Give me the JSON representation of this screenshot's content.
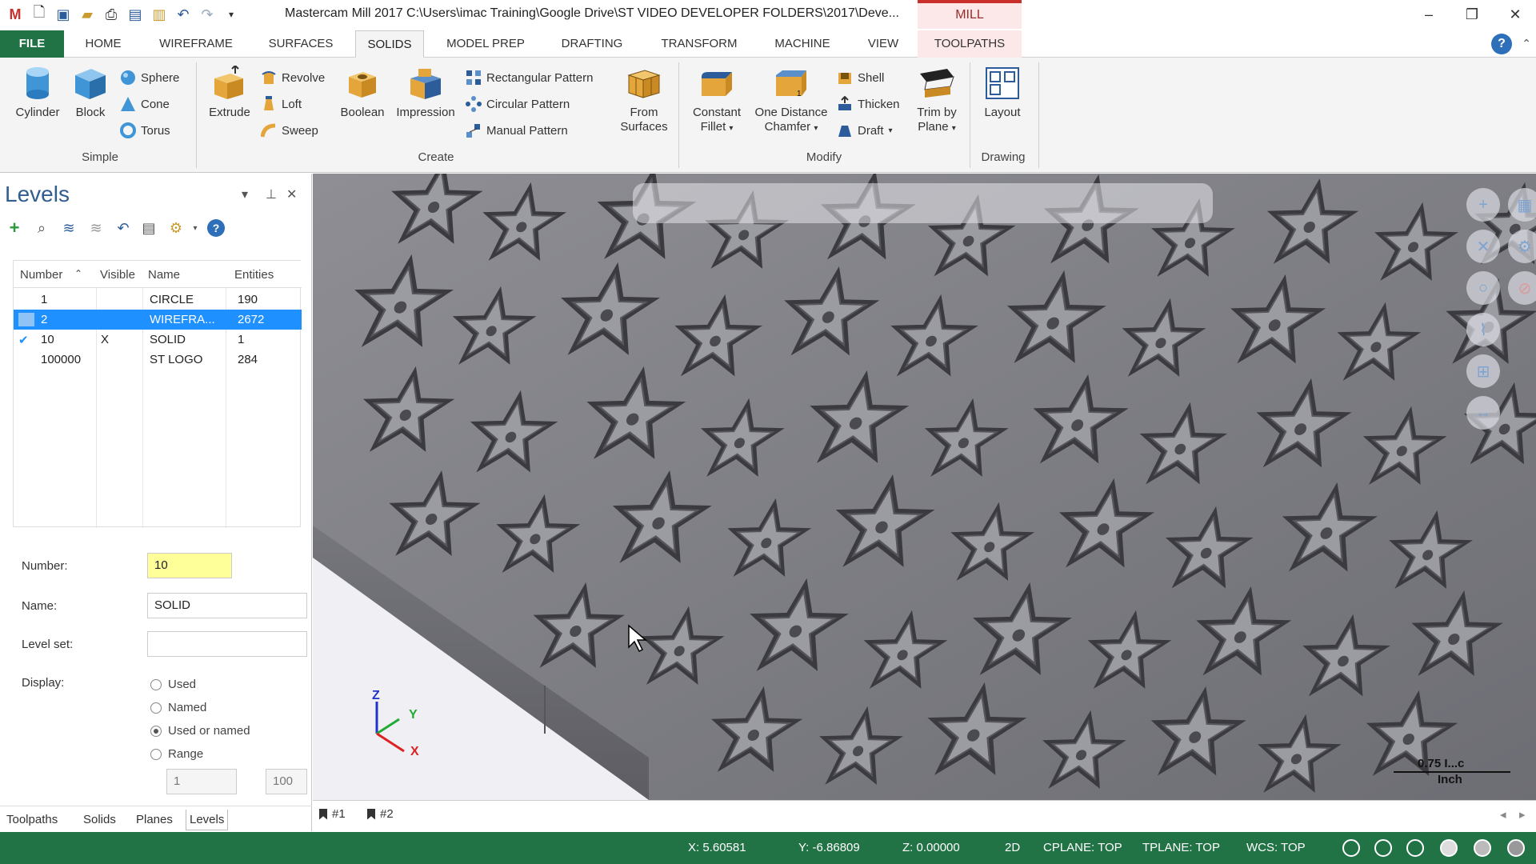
{
  "titlebar": {
    "title": "Mastercam Mill 2017  C:\\Users\\imac Training\\Google Drive\\ST VIDEO DEVELOPER FOLDERS\\2017\\Deve...",
    "context_tab": "MILL"
  },
  "tabs": {
    "file": "FILE",
    "home": "HOME",
    "wireframe": "WIREFRAME",
    "surfaces": "SURFACES",
    "solids": "SOLIDS",
    "model_prep": "MODEL PREP",
    "drafting": "DRAFTING",
    "transform": "TRANSFORM",
    "machine": "MACHINE",
    "view": "VIEW",
    "toolpaths": "TOOLPATHS"
  },
  "ribbon": {
    "simple": {
      "label": "Simple",
      "cylinder": "Cylinder",
      "block": "Block",
      "sphere": "Sphere",
      "cone": "Cone",
      "torus": "Torus"
    },
    "create": {
      "label": "Create",
      "extrude": "Extrude",
      "revolve": "Revolve",
      "loft": "Loft",
      "sweep": "Sweep",
      "boolean": "Boolean",
      "impression": "Impression",
      "rectangular_pattern": "Rectangular Pattern",
      "circular_pattern": "Circular Pattern",
      "manual_pattern": "Manual Pattern",
      "from_surfaces_1": "From",
      "from_surfaces_2": "Surfaces"
    },
    "modify": {
      "label": "Modify",
      "constant_fillet_1": "Constant",
      "constant_fillet_2": "Fillet",
      "one_distance_chamfer_1": "One Distance",
      "one_distance_chamfer_2": "Chamfer",
      "shell": "Shell",
      "thicken": "Thicken",
      "draft": "Draft",
      "trim_by_plane_1": "Trim by",
      "trim_by_plane_2": "Plane"
    },
    "drawing": {
      "label": "Drawing",
      "layout": "Layout"
    }
  },
  "levels_panel": {
    "title": "Levels",
    "columns": {
      "number": "Number",
      "visible": "Visible",
      "name": "Name",
      "entities": "Entities"
    },
    "rows": [
      {
        "number": "1",
        "visible": "",
        "name": "CIRCLE",
        "entities": "190"
      },
      {
        "number": "2",
        "visible": "",
        "name": "WIREFRA...",
        "entities": "2672"
      },
      {
        "number": "10",
        "visible": "X",
        "name": "SOLID",
        "entities": "1"
      },
      {
        "number": "100000",
        "visible": "",
        "name": "ST LOGO",
        "entities": "284"
      }
    ],
    "form": {
      "number_label": "Number:",
      "number_value": "10",
      "name_label": "Name:",
      "name_value": "SOLID",
      "level_set_label": "Level set:",
      "level_set_value": "",
      "display_label": "Display:",
      "options": [
        "Used",
        "Named",
        "Used or named",
        "Range"
      ],
      "selected_option": "Used or named",
      "range_from": "1",
      "range_to": "100"
    },
    "bottom_tabs": [
      "Toolpaths",
      "Solids",
      "Planes",
      "Levels"
    ],
    "active_bottom_tab": "Levels"
  },
  "viewport": {
    "axes": {
      "z": "Z",
      "y": "Y",
      "x": "X"
    },
    "scale_value": "0.75 I...c",
    "scale_unit": "Inch"
  },
  "viewsheets": [
    "#1",
    "#2"
  ],
  "statusbar": {
    "x": "X:  5.60581",
    "y": "Y:  -6.86809",
    "z": "Z:  0.00000",
    "mode": "2D",
    "cplane": "CPLANE: TOP",
    "tplane": "TPLANE: TOP",
    "wcs": "WCS: TOP"
  },
  "colors": {
    "brand_green": "#217346",
    "selection_blue": "#1e90ff",
    "number_highlight": "#ffff99",
    "mill_red": "#c9302c"
  }
}
